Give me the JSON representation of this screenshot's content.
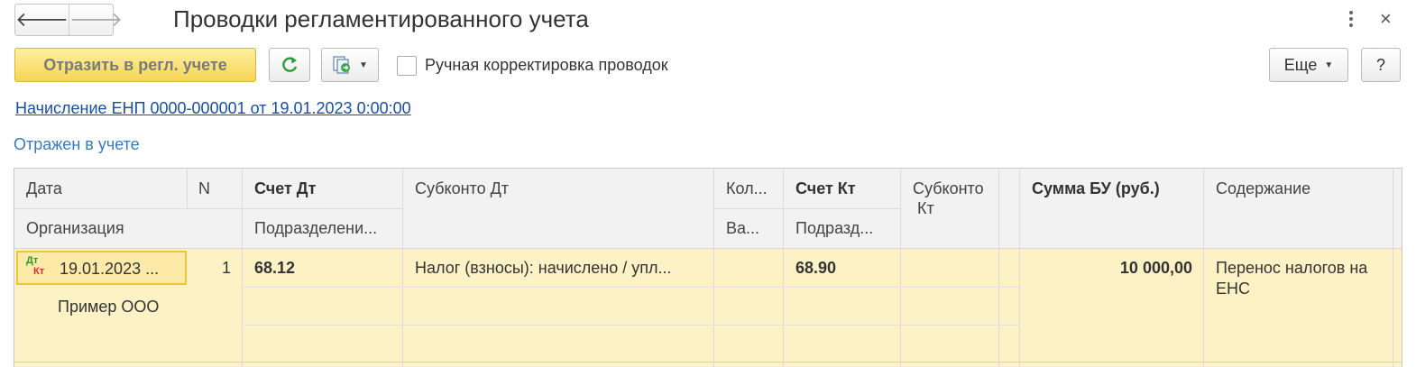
{
  "window": {
    "title": "Проводки регламентированного учета",
    "close_glyph": "×"
  },
  "nav": {
    "back_glyph": "🡐",
    "forward_glyph": "🡒"
  },
  "toolbar": {
    "post_button": "Отразить в регл. учете",
    "refresh_glyph": "↻",
    "manual_checkbox_label": "Ручная корректировка проводок",
    "manual_checkbox_checked": false,
    "more_button": "Еще",
    "help_button": "?"
  },
  "document_link": "Начисление ЕНП 0000-000001 от 19.01.2023 0:00:00",
  "status": "Отражен в учете",
  "table": {
    "headers": {
      "date": "Дата",
      "number": "N",
      "account_dt": "Счет Дт",
      "subconto_dt": "Субконто Дт",
      "quantity": "Кол...",
      "account_kt": "Счет Кт",
      "subconto_kt_line1": "Субконто",
      "subconto_kt_line2": "Кт",
      "sum": "Сумма БУ (руб.)",
      "content": "Содержание",
      "organization": "Организация",
      "division_dt": "Подразделени...",
      "currency": "Ва...",
      "division_kt": "Подразд..."
    },
    "rows": [
      {
        "dt_label": "Дт",
        "kt_label": "Кт",
        "date": "19.01.2023 ...",
        "number": "1",
        "account_dt": "68.12",
        "subconto_dt": "Налог (взносы): начислено / упл...",
        "account_kt": "68.90",
        "sum": "10 000,00",
        "content_line1": "Перенос налогов на",
        "content_line2": "ЕНС",
        "organization": "Пример ООО"
      }
    ]
  },
  "colors": {
    "accent_yellow": "#f5d555",
    "link_blue": "#1b4e9b",
    "status_blue": "#3a7ab8",
    "row_highlight": "#fdf1c6",
    "dt_green": "#2a9a2a",
    "kt_red": "#d23030",
    "refresh_green": "#2e9a3a"
  },
  "icons": [
    "arrow-left-icon",
    "arrow-right-icon",
    "more-vertical-icon",
    "close-icon",
    "refresh-icon",
    "documents-icon",
    "chevron-down-icon",
    "dt-kt-icon"
  ]
}
